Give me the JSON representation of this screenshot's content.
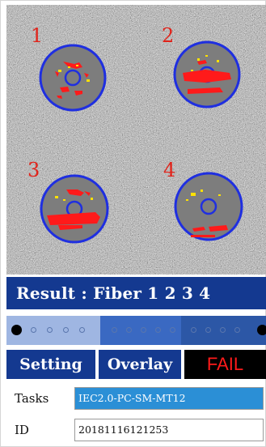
{
  "result": {
    "text": "Result : Fiber 1 2 3 4"
  },
  "fibers": [
    {
      "label": "1"
    },
    {
      "label": "2"
    },
    {
      "label": "3"
    },
    {
      "label": "4"
    }
  ],
  "colors": {
    "panel": "#143990",
    "ring": "#1f2fe0",
    "defect": "#ff1a1a",
    "particle": "#ffe100",
    "fiber_label": "#e0231a",
    "fail_text": "#ff1a1a",
    "tasks_field": "#2b8fd6"
  },
  "buttons": {
    "setting": "Setting",
    "overlay": "Overlay"
  },
  "status": {
    "text": "FAIL"
  },
  "form": {
    "tasks_label": "Tasks",
    "tasks_value": "IEC2.0-PC-SM-MT12",
    "id_label": "ID",
    "id_value": "20181116121253"
  }
}
